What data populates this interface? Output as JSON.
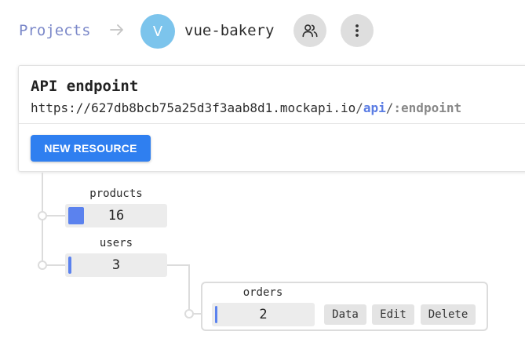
{
  "breadcrumb": {
    "projects_label": "Projects",
    "avatar_letter": "V",
    "project_name": "vue-bakery"
  },
  "api": {
    "title": "API endpoint",
    "url_base": "https://627db8bcb75a25d3f3aab8d1.mockapi.io",
    "url_sep1": "/",
    "url_api": "api",
    "url_sep2": "/",
    "url_endpoint": ":endpoint",
    "new_resource_label": "NEW RESOURCE"
  },
  "resources": [
    {
      "name": "products",
      "count": "16",
      "fill": 0.16
    },
    {
      "name": "users",
      "count": "3",
      "fill": 0.03
    },
    {
      "name": "orders",
      "count": "2",
      "fill": 0.02,
      "actions": {
        "data": "Data",
        "edit": "Edit",
        "delete": "Delete"
      }
    }
  ],
  "colors": {
    "accent": "#2f7ff0",
    "link": "#7b88c9",
    "avatar": "#7cc4ec",
    "count_fill": "#5b82ee"
  },
  "icons": {
    "arrow": "arrow-right-icon",
    "users": "users-icon",
    "more": "more-vertical-icon"
  }
}
